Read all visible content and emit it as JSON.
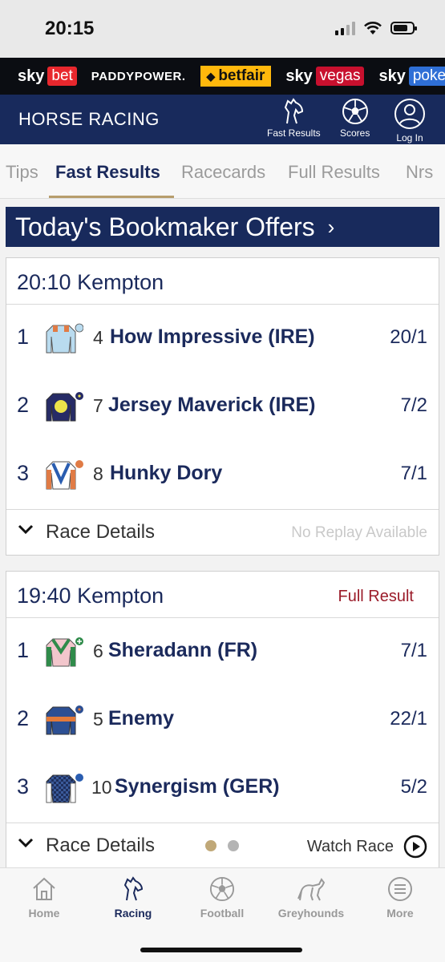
{
  "status_bar": {
    "time": "20:15",
    "battery_level": 0.75
  },
  "brands": [
    {
      "name": "sky",
      "box": "bet",
      "color": "#e8272d"
    },
    {
      "name": "PADDYPOWER.",
      "color": "#0a8f4f"
    },
    {
      "name": "betfair",
      "color": "#ffb80c"
    },
    {
      "name": "sky",
      "box": "vegas",
      "color": "#c8102e"
    },
    {
      "name": "sky",
      "box": "poke",
      "color": "#2f6fd6"
    }
  ],
  "header": {
    "title": "HORSE RACING",
    "buttons": [
      {
        "label": "Fast Results",
        "icon": "horse-head-icon"
      },
      {
        "label": "Scores",
        "icon": "football-icon"
      },
      {
        "label": "Log In",
        "icon": "user-icon"
      }
    ]
  },
  "tabs": [
    {
      "label": "Tips",
      "active": false
    },
    {
      "label": "Fast Results",
      "active": true
    },
    {
      "label": "Racecards",
      "active": false
    },
    {
      "label": "Full Results",
      "active": false
    },
    {
      "label": "Nrs",
      "active": false
    }
  ],
  "offers_banner": {
    "label": "Today's Bookmaker Offers",
    "chevron": "›"
  },
  "races": [
    {
      "title": "20:10 Kempton",
      "full_result_label": "",
      "runners": [
        {
          "pos": "1",
          "number": "4",
          "horse": "How Impressive (IRE)",
          "odds": "20/1",
          "silk_primary": "#b9dbef",
          "silk_accent": "#e07b45",
          "silk_cap": "#b9dbef"
        },
        {
          "pos": "2",
          "number": "7",
          "horse": "Jersey Maverick (IRE)",
          "odds": "7/2",
          "silk_primary": "#262b66",
          "silk_accent": "#ece34a",
          "silk_cap": "#262b66"
        },
        {
          "pos": "3",
          "number": "8",
          "horse": "Hunky Dory",
          "odds": "7/1",
          "silk_primary": "#ffffff",
          "silk_accent": "#2a5db0",
          "silk_cap": "#e07b45"
        }
      ],
      "details_label": "Race Details",
      "replay_label": "No Replay Available"
    },
    {
      "title": "19:40 Kempton",
      "full_result_label": "Full Result",
      "runners": [
        {
          "pos": "1",
          "number": "6",
          "horse": "Sheradann (FR)",
          "odds": "7/1",
          "silk_primary": "#f2c6cc",
          "silk_accent": "#2f8b4a",
          "silk_cap": "#2f8b4a"
        },
        {
          "pos": "2",
          "number": "5",
          "horse": "Enemy",
          "odds": "22/1",
          "silk_primary": "#2c4f93",
          "silk_accent": "#e27a3a",
          "silk_cap": "#2c4f93"
        },
        {
          "pos": "3",
          "number": "10",
          "horse": "Synergism (GER)",
          "odds": "5/2",
          "silk_primary": "#1f2f5c",
          "silk_accent": "#ffffff",
          "silk_cap": "#2a5db0"
        }
      ],
      "details_label": "Race Details",
      "watch_label": "Watch Race"
    }
  ],
  "carousel": {
    "active_color": "#c0a878",
    "inactive_color": "#b4b4b4"
  },
  "bottom_nav": [
    {
      "label": "Home",
      "icon": "home-icon",
      "active": false
    },
    {
      "label": "Racing",
      "icon": "horse-head-icon",
      "active": true
    },
    {
      "label": "Football",
      "icon": "football-icon",
      "active": false
    },
    {
      "label": "Greyhounds",
      "icon": "greyhound-icon",
      "active": false
    },
    {
      "label": "More",
      "icon": "menu-icon",
      "active": false
    }
  ]
}
